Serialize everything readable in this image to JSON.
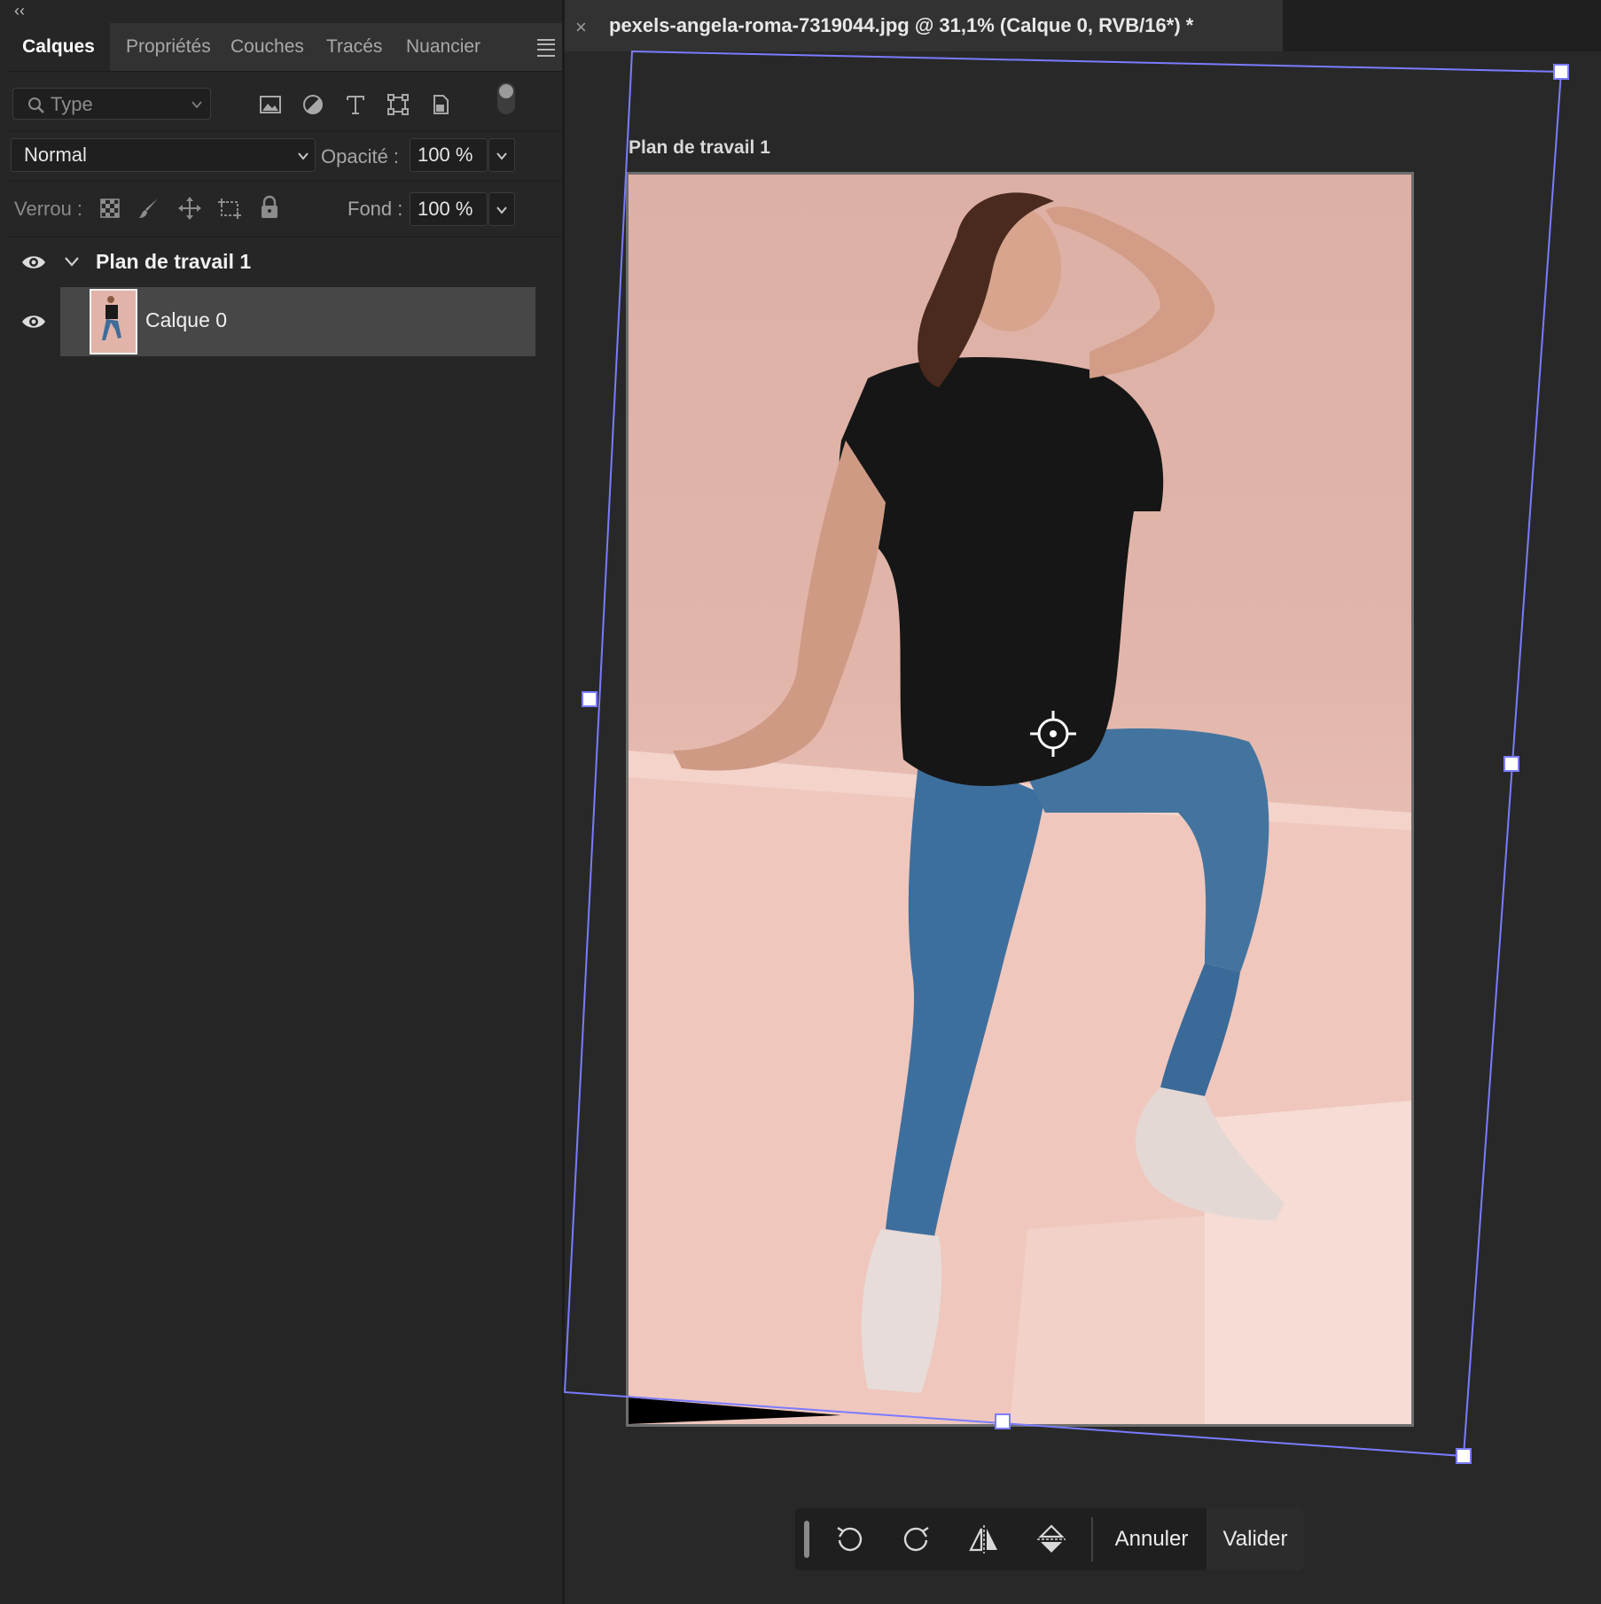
{
  "panel": {
    "collapse_glyph": "‹‹",
    "tabs": [
      "Calques",
      "Propriétés",
      "Couches",
      "Tracés",
      "Nuancier"
    ],
    "active_tab": "Calques",
    "filter": {
      "search_label": "Type",
      "icons": [
        "image-filter-icon",
        "adjustment-filter-icon",
        "type-filter-icon",
        "shape-filter-icon",
        "smart-object-filter-icon"
      ]
    },
    "blend_mode": "Normal",
    "opacity_label": "Opacité :",
    "opacity_value": "100 %",
    "lock_label": "Verrou :",
    "fill_label": "Fond :",
    "fill_value": "100 %",
    "layers": [
      {
        "name": "Plan de travail 1",
        "type": "artboard",
        "visible": true,
        "expanded": true
      },
      {
        "name": "Calque 0",
        "type": "layer",
        "visible": true,
        "selected": true
      }
    ]
  },
  "document": {
    "tab_title": "pexels-angela-roma-7319044.jpg @ 31,1% (Calque 0, RVB/16*) *",
    "close_glyph": "×",
    "artboard_label": "Plan de travail 1"
  },
  "transform_bar": {
    "buttons": [
      "rotate-left-icon",
      "rotate-right-icon",
      "flip-horizontal-icon",
      "flip-vertical-icon"
    ],
    "cancel_label": "Annuler",
    "commit_label": "Valider"
  },
  "colors": {
    "panel_bg": "#262626",
    "canvas_bg": "#282828",
    "transform_line": "#7b7bff",
    "selected_layer": "#474747"
  }
}
